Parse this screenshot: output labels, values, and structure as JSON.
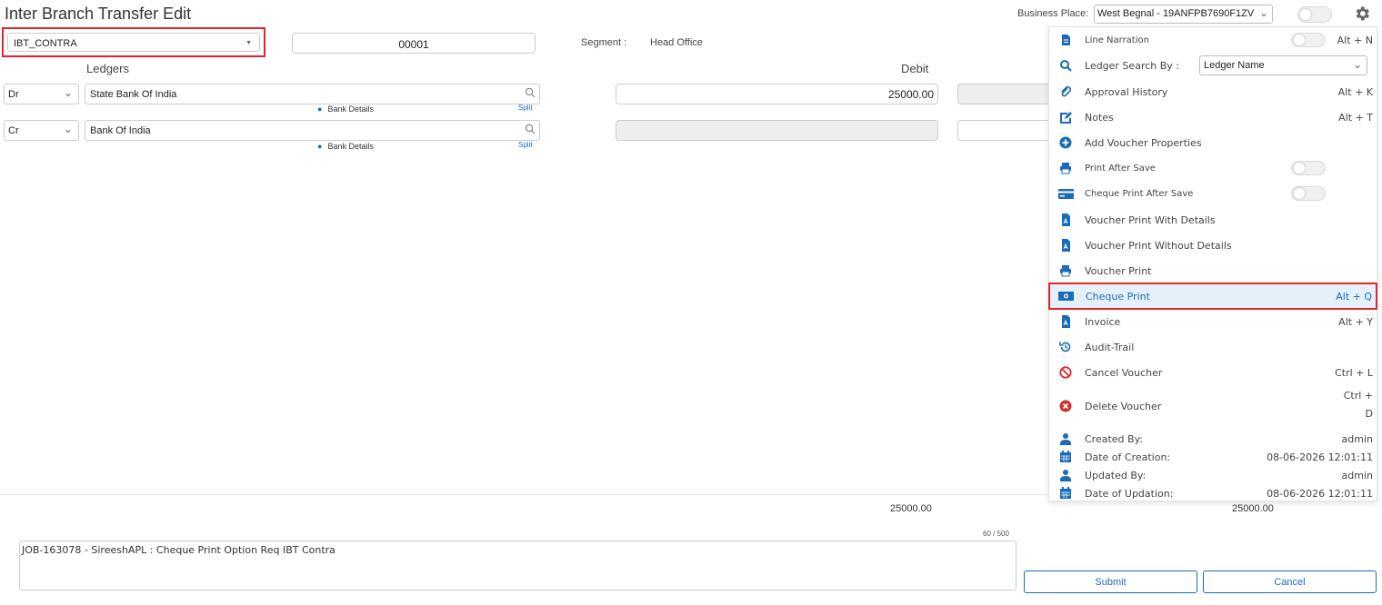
{
  "page": {
    "title": "Inter Branch Transfer Edit"
  },
  "header": {
    "business_place_label": "Business Place:",
    "business_place_value": "West Begnal - 19ANFPB7690F1ZV"
  },
  "voucher": {
    "type": "IBT_CONTRA",
    "number": "00001",
    "segment_label": "Segment :",
    "segment_value": "Head Office"
  },
  "columns": {
    "ledgers": "Ledgers",
    "debit": "Debit"
  },
  "rows": [
    {
      "drcr": "Dr",
      "ledger": "State Bank Of India",
      "bank_details": "Bank Details",
      "split": "Split",
      "debit": "25000.00"
    },
    {
      "drcr": "Cr",
      "ledger": "Bank Of India",
      "bank_details": "Bank Details",
      "split": "Split",
      "debit": ""
    }
  ],
  "totals": {
    "debit": "25000.00",
    "credit": "25000.00"
  },
  "narration": {
    "char_count": "60 / 500",
    "text": "JOB-163078 - SireeshAPL : Cheque Print Option Req IBT Contra"
  },
  "buttons": {
    "submit": "Submit",
    "cancel": "Cancel"
  },
  "menu": {
    "line_narration": {
      "label": "Line Narration",
      "shortcut": "Alt + N"
    },
    "ledger_search": {
      "label": "Ledger Search By :",
      "value": "Ledger Name"
    },
    "approval_history": {
      "label": "Approval History",
      "shortcut": "Alt + K"
    },
    "notes": {
      "label": "Notes",
      "shortcut": "Alt + T"
    },
    "add_voucher_properties": {
      "label": "Add Voucher Properties"
    },
    "print_after_save": {
      "label": "Print After Save"
    },
    "cheque_print_after_save": {
      "label": "Cheque Print After Save"
    },
    "voucher_print_with_details": {
      "label": "Voucher Print With Details"
    },
    "voucher_print_without_details": {
      "label": "Voucher Print Without Details"
    },
    "voucher_print": {
      "label": "Voucher Print"
    },
    "cheque_print": {
      "label": "Cheque Print",
      "shortcut": "Alt + Q"
    },
    "invoice": {
      "label": "Invoice",
      "shortcut": "Alt + Y"
    },
    "audit_trail": {
      "label": "Audit-Trail"
    },
    "cancel_voucher": {
      "label": "Cancel Voucher",
      "shortcut": "Ctrl + L"
    },
    "delete_voucher": {
      "label": "Delete Voucher",
      "shortcut_line1": "Ctrl +",
      "shortcut_line2": "D"
    },
    "created_by": {
      "label": "Created By:",
      "value": "admin"
    },
    "date_of_creation": {
      "label": "Date of Creation:",
      "value": "08-06-2026 12:01:11"
    },
    "updated_by": {
      "label": "Updated By:",
      "value": "admin"
    },
    "date_of_updation": {
      "label": "Date of Updation:",
      "value": "08-06-2026 12:01:11"
    }
  },
  "colors": {
    "accent": "#1a6bb8",
    "highlight_border": "#e0262b",
    "delete_icon": "#d32f2f",
    "cancel_icon": "#e0262b"
  }
}
